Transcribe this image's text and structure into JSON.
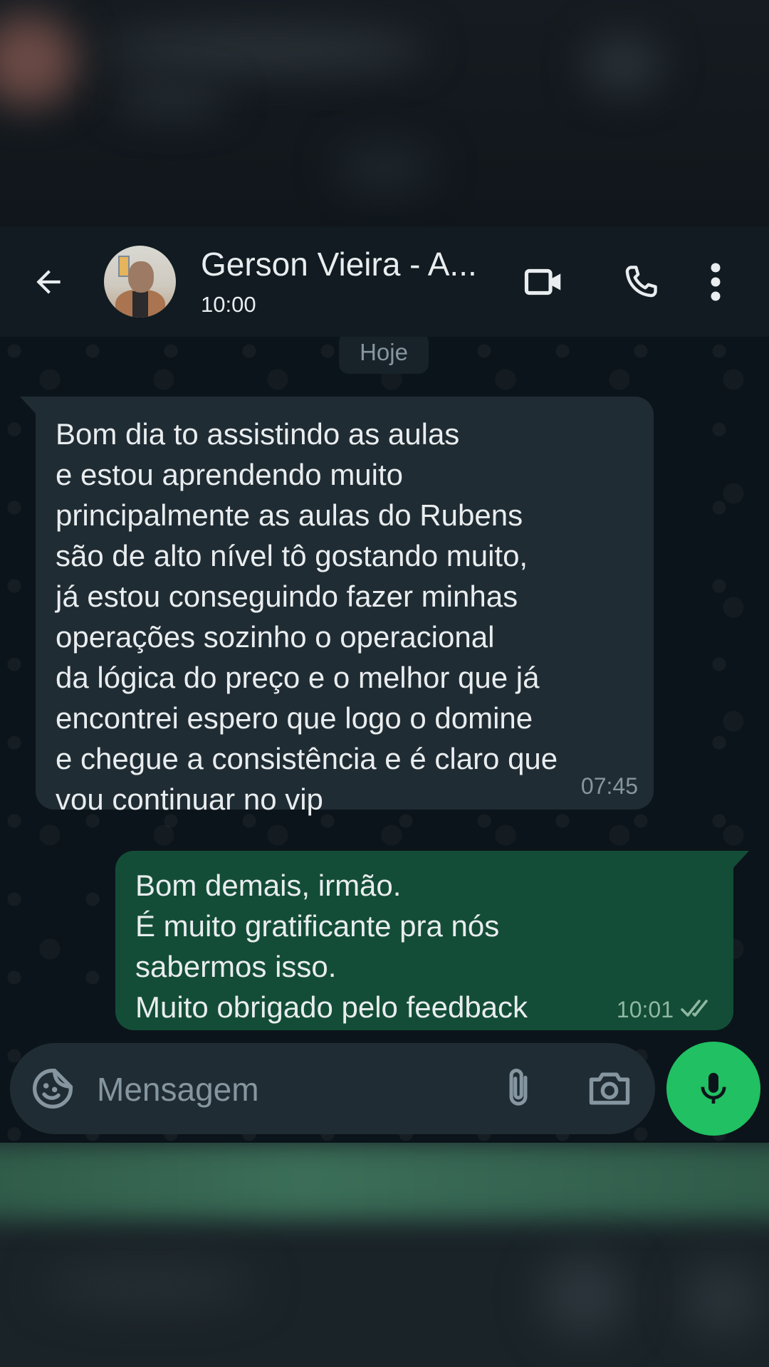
{
  "header": {
    "contact_name": "Gerson Vieira - A...",
    "status": "10:00",
    "back_icon": "arrow-left-icon",
    "video_icon": "video-call-icon",
    "call_icon": "phone-icon",
    "menu_icon": "more-vert-icon"
  },
  "chat": {
    "day_label": "Hoje",
    "messages": [
      {
        "direction": "incoming",
        "lines": [
          "Bom dia to assistindo as aulas",
          "e estou aprendendo muito",
          "principalmente as aulas do Rubens",
          "são de alto nível tô gostando muito,",
          "já estou conseguindo fazer minhas",
          "operações sozinho o operacional",
          "da lógica do preço e o melhor que já",
          "encontrei espero que logo o domine",
          "e chegue a consistência e é claro que",
          "vou continuar no vip"
        ],
        "time": "07:45"
      },
      {
        "direction": "outgoing",
        "lines": [
          "Bom demais, irmão.",
          "É muito gratificante pra nós",
          "sabermos isso.",
          "Muito obrigado pelo feedback"
        ],
        "time": "10:01",
        "status_icon": "double-check-read-icon"
      }
    ]
  },
  "composer": {
    "placeholder": "Mensagem",
    "sticker_icon": "sticker-icon",
    "attach_icon": "paperclip-icon",
    "camera_icon": "camera-icon",
    "mic_icon": "microphone-icon"
  },
  "colors": {
    "background": "#0b141a",
    "header": "#111b21",
    "incoming_bubble": "#202c33",
    "outgoing_bubble": "#144d37",
    "mic_button": "#21c063"
  }
}
